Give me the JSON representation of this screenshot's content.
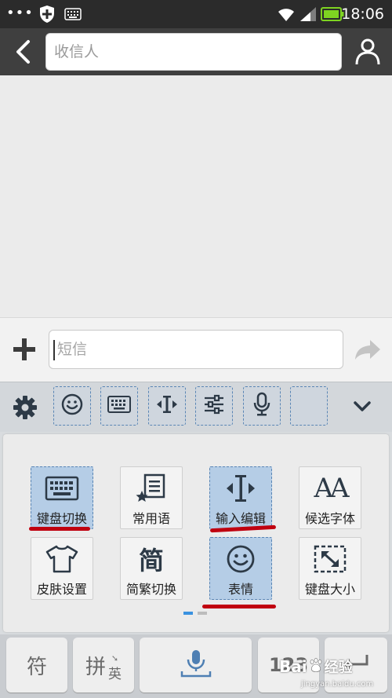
{
  "status": {
    "time": "18:06",
    "dots": "•••"
  },
  "header": {
    "recipient_placeholder": "收信人"
  },
  "compose": {
    "sms_placeholder": "短信"
  },
  "panel": {
    "tiles": [
      {
        "label": "键盘切换"
      },
      {
        "label": "常用语"
      },
      {
        "label": "输入编辑"
      },
      {
        "label": "候选字体"
      },
      {
        "label": "皮肤设置"
      },
      {
        "label": "简繁切换"
      },
      {
        "label": "表情"
      },
      {
        "label": "键盘大小"
      }
    ],
    "font_icon_text": "AA",
    "simplified_icon_text": "简"
  },
  "keyboard": {
    "symbol_key": "符",
    "pinyin_key": "拼",
    "english_key": "英",
    "number_key": "123"
  },
  "watermark": {
    "brand": "Bai",
    "brand2": "经验",
    "url": "jingyan.baidu.com"
  },
  "colors": {
    "selected_tile": "#b5cde6",
    "annotation_red": "#c00010",
    "battery": "#7ed321"
  }
}
